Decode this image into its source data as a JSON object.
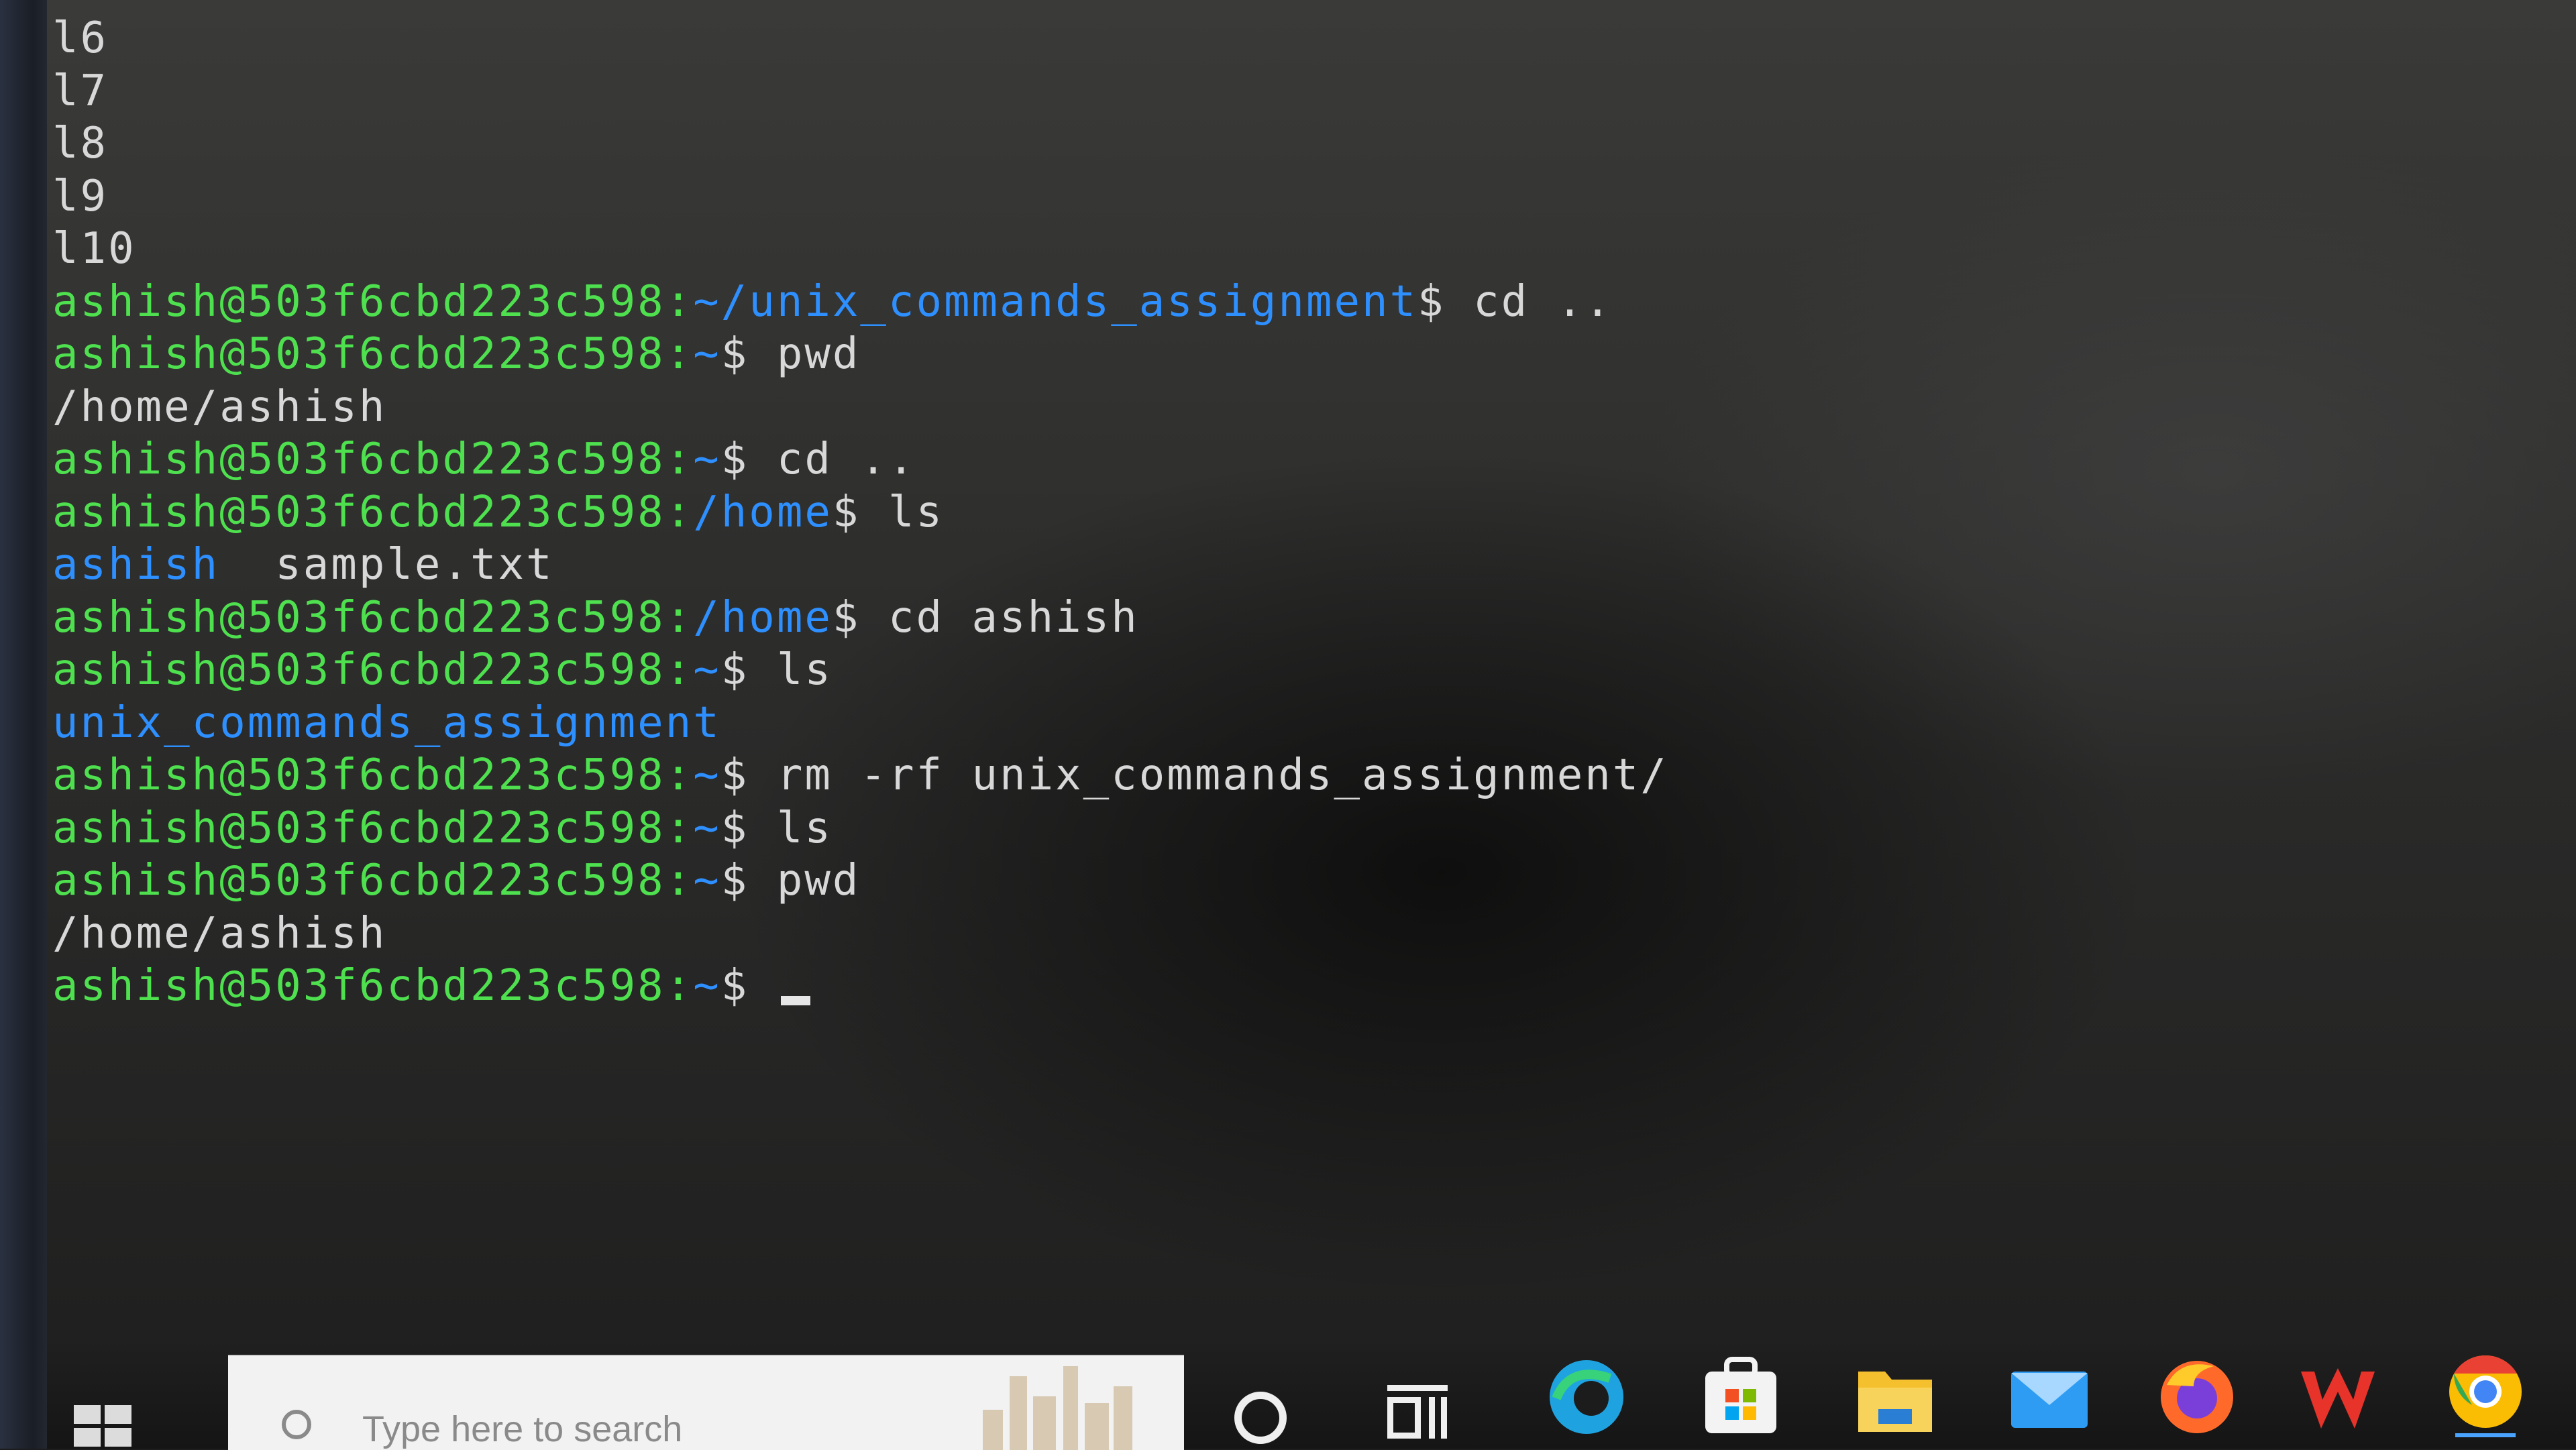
{
  "terminal": {
    "lines": [
      {
        "type": "out",
        "text": "l6"
      },
      {
        "type": "out",
        "text": "l7"
      },
      {
        "type": "out",
        "text": "l8"
      },
      {
        "type": "out",
        "text": "l9"
      },
      {
        "type": "out",
        "text": "l10"
      },
      {
        "type": "prompt",
        "user": "ashish@503f6cbd223c598",
        "path": "~/unix_commands_assignment",
        "cmd": "cd .."
      },
      {
        "type": "prompt",
        "user": "ashish@503f6cbd223c598",
        "path": "~",
        "cmd": "pwd"
      },
      {
        "type": "out",
        "text": "/home/ashish"
      },
      {
        "type": "prompt",
        "user": "ashish@503f6cbd223c598",
        "path": "~",
        "cmd": "cd .."
      },
      {
        "type": "prompt",
        "user": "ashish@503f6cbd223c598",
        "path": "/home",
        "cmd": "ls"
      },
      {
        "type": "ls",
        "dir": "ashish",
        "file": "sample.txt"
      },
      {
        "type": "prompt",
        "user": "ashish@503f6cbd223c598",
        "path": "/home",
        "cmd": "cd ashish"
      },
      {
        "type": "prompt",
        "user": "ashish@503f6cbd223c598",
        "path": "~",
        "cmd": "ls"
      },
      {
        "type": "dirline",
        "text": "unix_commands_assignment"
      },
      {
        "type": "prompt",
        "user": "ashish@503f6cbd223c598",
        "path": "~",
        "cmd": "rm -rf unix_commands_assignment/"
      },
      {
        "type": "prompt",
        "user": "ashish@503f6cbd223c598",
        "path": "~",
        "cmd": "ls"
      },
      {
        "type": "prompt",
        "user": "ashish@503f6cbd223c598",
        "path": "~",
        "cmd": "pwd"
      },
      {
        "type": "out",
        "text": "/home/ashish"
      },
      {
        "type": "prompt",
        "user": "ashish@503f6cbd223c598",
        "path": "~",
        "cmd": "",
        "cursor": true
      }
    ]
  },
  "taskbar": {
    "search_placeholder": "Type here to search",
    "apps": [
      {
        "icon": "edge-icon",
        "color": "#1fa3e0"
      },
      {
        "icon": "store-icon",
        "color": "#f3f3f3"
      },
      {
        "icon": "file-explorer-icon",
        "color": "#f5c02d"
      },
      {
        "icon": "mail-icon",
        "color": "#2e9cf2"
      },
      {
        "icon": "firefox-icon",
        "color": "#ff6a2b"
      },
      {
        "icon": "wps-office-icon",
        "color": "#e8332b"
      },
      {
        "icon": "chrome-icon",
        "color": "#e94235"
      }
    ]
  },
  "colors": {
    "prompt_user": "#4ee04e",
    "prompt_path": "#2e8fff",
    "output": "#d8d8d8"
  }
}
